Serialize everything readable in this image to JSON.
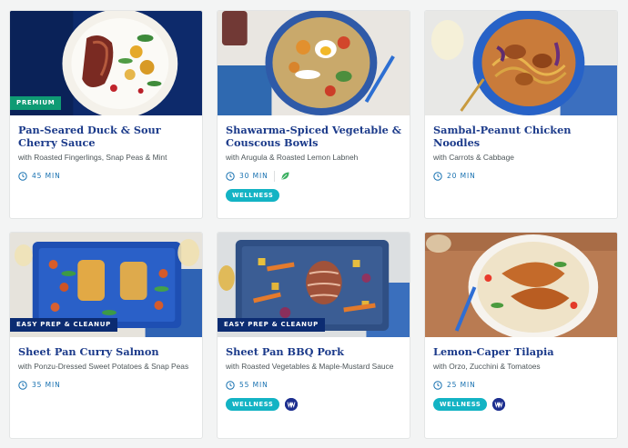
{
  "cards": [
    {
      "title": "Pan-Seared Duck & Sour Cherry Sauce",
      "subtitle": "with Roasted Fingerlings, Snap Peas & Mint",
      "time": "45 MIN",
      "tag": "PREMIUM"
    },
    {
      "title": "Shawarma-Spiced Vegetable & Couscous Bowls",
      "subtitle": "with Arugula & Roasted Lemon Labneh",
      "time": "30 MIN",
      "icons": [
        "leaf-icon"
      ],
      "badge": "WELLNESS"
    },
    {
      "title": "Sambal-Peanut Chicken Noodles",
      "subtitle": "with Carrots & Cabbage",
      "time": "20 MIN"
    },
    {
      "title": "Sheet Pan Curry Salmon",
      "subtitle": "with Ponzu-Dressed Sweet Potatoes & Snap Peas",
      "time": "35 MIN",
      "tag": "EASY PREP & CLEANUP"
    },
    {
      "title": "Sheet Pan BBQ Pork",
      "subtitle": "with Roasted Vegetables & Maple-Mustard Sauce",
      "time": "55 MIN",
      "tag": "EASY PREP & CLEANUP",
      "badge": "WELLNESS",
      "icons": [
        "ww-icon"
      ]
    },
    {
      "title": "Lemon-Caper Tilapia",
      "subtitle": "with Orzo, Zucchini & Tomatoes",
      "time": "25 MIN",
      "badge": "WELLNESS",
      "icons": [
        "ww-icon"
      ]
    }
  ],
  "colors": {
    "title": "#1b3a8a",
    "time": "#1670b0",
    "premium": "#0f9b74",
    "easy_prep": "#0c2c72",
    "wellness": "#13b3c4"
  }
}
